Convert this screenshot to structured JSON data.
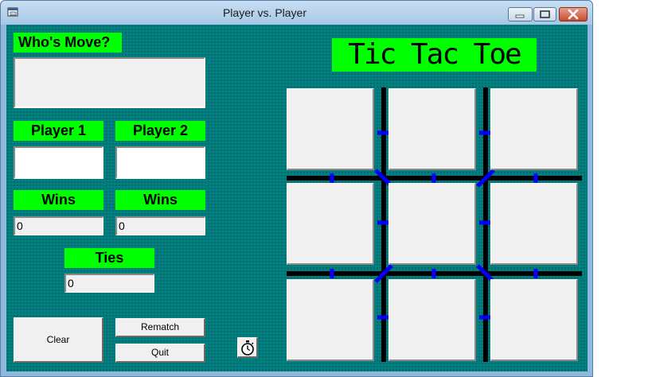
{
  "window": {
    "title": "Player vs. Player"
  },
  "labels": {
    "whos_move": "Who's Move?",
    "player1": "Player 1",
    "player2": "Player 2",
    "wins1": "Wins",
    "wins2": "Wins",
    "ties": "Ties"
  },
  "fields": {
    "whos_move_value": "",
    "player1_name": "",
    "player2_name": "",
    "player1_wins": "0",
    "player2_wins": "0",
    "ties": "0"
  },
  "buttons": {
    "clear": "Clear",
    "rematch": "Rematch",
    "quit": "Quit"
  },
  "banner": "Tic Tac Toe",
  "board": {
    "cells": [
      "",
      "",
      "",
      "",
      "",
      "",
      "",
      "",
      ""
    ]
  },
  "colors": {
    "background": "#008080",
    "label": "#00ff00",
    "grid_line": "#000000",
    "grid_mark": "#0000ff"
  }
}
